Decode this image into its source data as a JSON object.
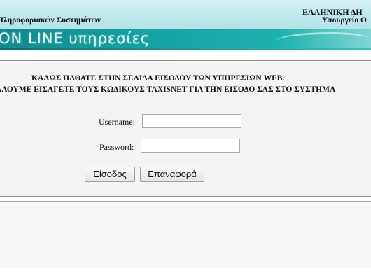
{
  "header": {
    "organization": "Πληροφοριακών Συστημάτων",
    "country": "ΕΛΛΗΝΙΚΗ ΔΗ",
    "ministry": "Υπουργείο Ο"
  },
  "banner": {
    "text": "ON LINE υπηρεσίες"
  },
  "login": {
    "welcome": "ΚΑΛΩΣ ΗΛΘΑΤΕ ΣΤΗΝ ΣΕΛΙΔΑ ΕΙΣΟΔΟΥ ΤΩΝ ΥΠΗΡΕΣΙΩΝ WEB.",
    "instructions": "ΑΛΟΥΜΕ ΕΙΣΑΓΕΤΕ ΤΟΥΣ ΚΩΔΙΚΟΥΣ TAXISNET ΓΙΑ ΤΗΝ ΕΙΣΟΔΟ ΣΑΣ ΣΤΟ ΣΥΣΤΗΜΑ",
    "username_label": "Username:",
    "username_value": "",
    "password_label": "Password:",
    "password_value": "",
    "submit_label": "Είσοδος",
    "reset_label": "Επαναφορά"
  },
  "colors": {
    "header_bg": "#c4eaee",
    "banner_bg": "#14a3a3",
    "panel_bg": "#f4f4f4"
  }
}
